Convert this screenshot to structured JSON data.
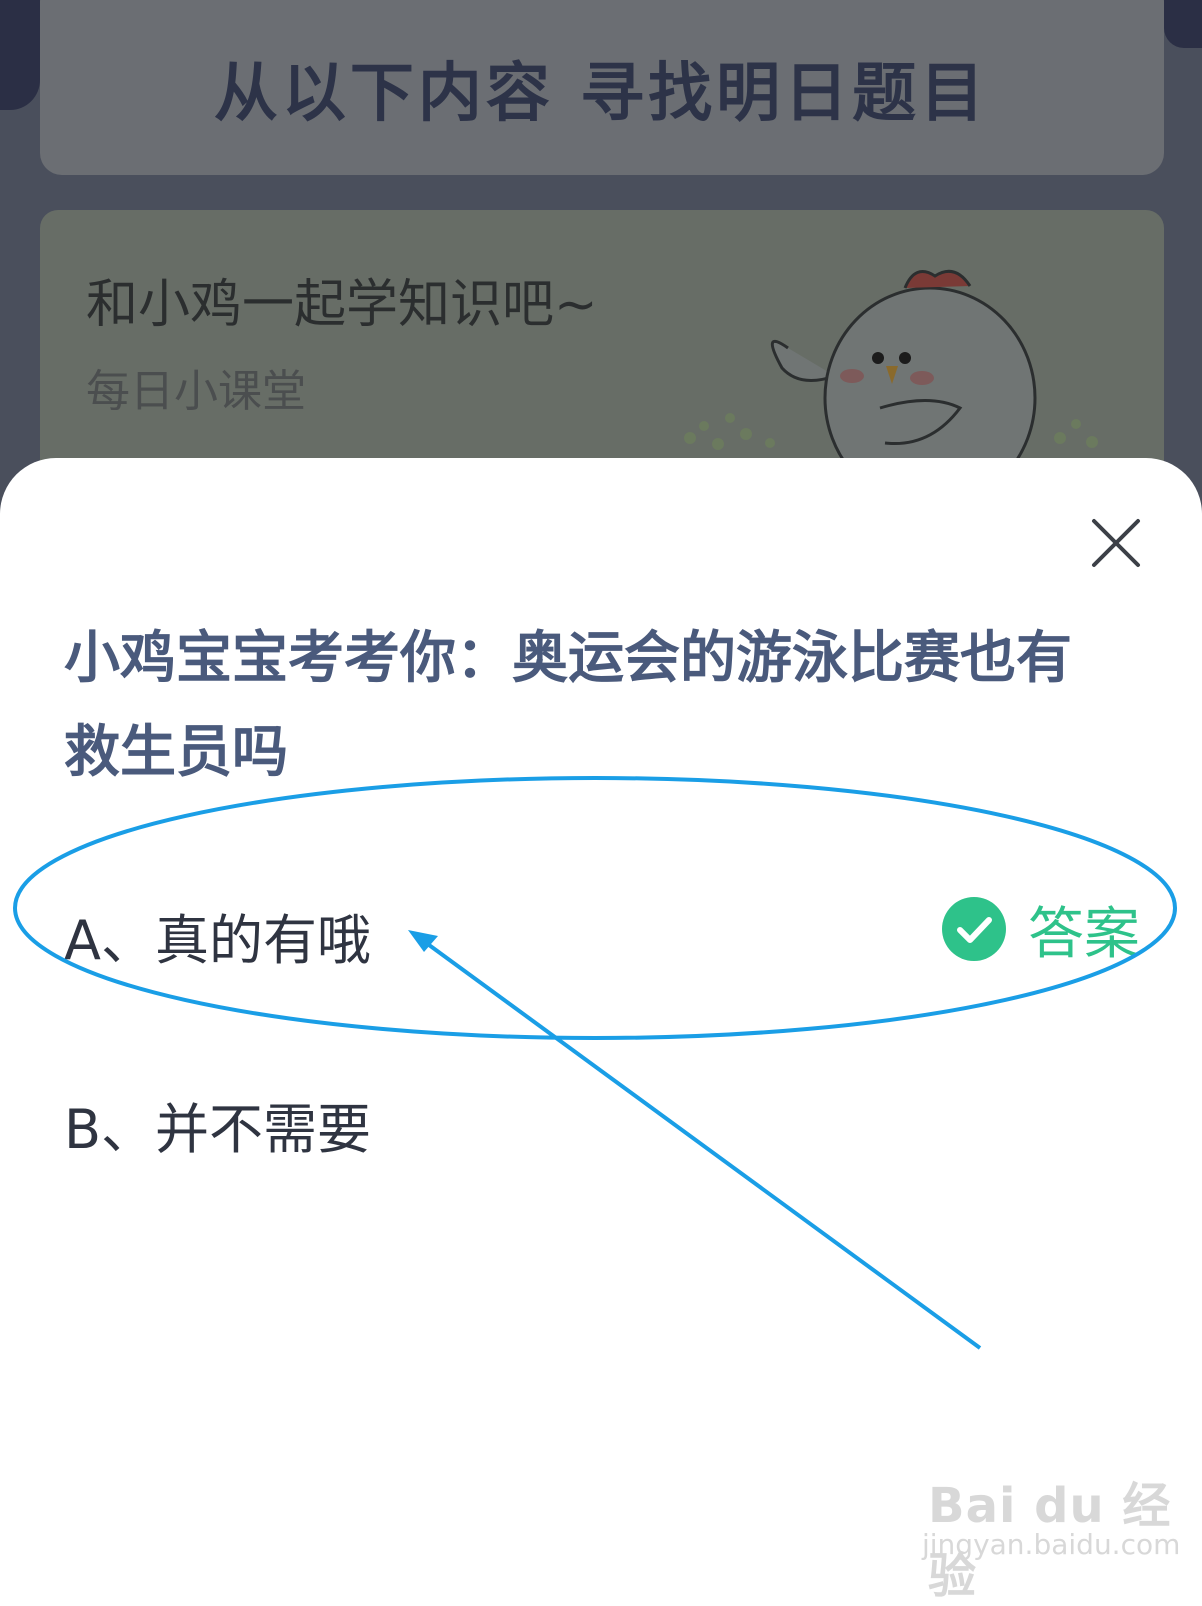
{
  "background": {
    "banner_title": "从以下内容 寻找明日题目",
    "lesson_title": "和小鸡一起学知识吧~",
    "lesson_subtitle": "每日小课堂",
    "mascot_icon": "chicken-mascot-illustration"
  },
  "dialog": {
    "close_icon": "close-icon",
    "question": "小鸡宝宝考考你：奥运会的游泳比赛也有救生员吗",
    "options": [
      {
        "label": "A、真的有哦",
        "is_answer": true
      },
      {
        "label": "B、并不需要",
        "is_answer": false
      }
    ],
    "answer_label": "答案",
    "answer_icon": "check-circle-icon",
    "answer_color": "#2ec28a"
  },
  "annotation": {
    "color": "#1a9ee6",
    "shapes": [
      "ellipse-highlight",
      "arrow"
    ]
  },
  "watermark": {
    "brand": "Bai du 经验",
    "url": "jingyan.baidu.com"
  }
}
